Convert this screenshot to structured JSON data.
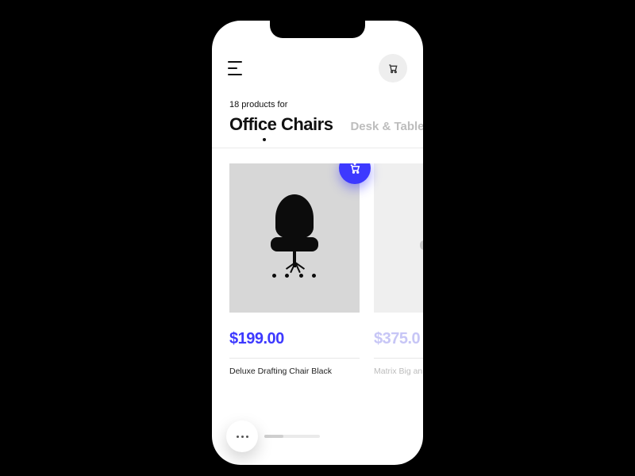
{
  "header": {
    "menu_icon": "menu-icon",
    "cart_icon": "cart-icon"
  },
  "listing": {
    "count_text": "18 products for",
    "active_category": "Office Chairs",
    "inactive_category": "Desk & Table"
  },
  "products": [
    {
      "price": "$199.00",
      "name": "Deluxe Drafting Chair Black",
      "add_icon": "add-to-cart-icon"
    },
    {
      "price": "$375.0",
      "name": "Matrix Big an"
    }
  ],
  "footer": {
    "more_icon": "more-icon"
  },
  "colors": {
    "accent": "#3d39ff"
  }
}
